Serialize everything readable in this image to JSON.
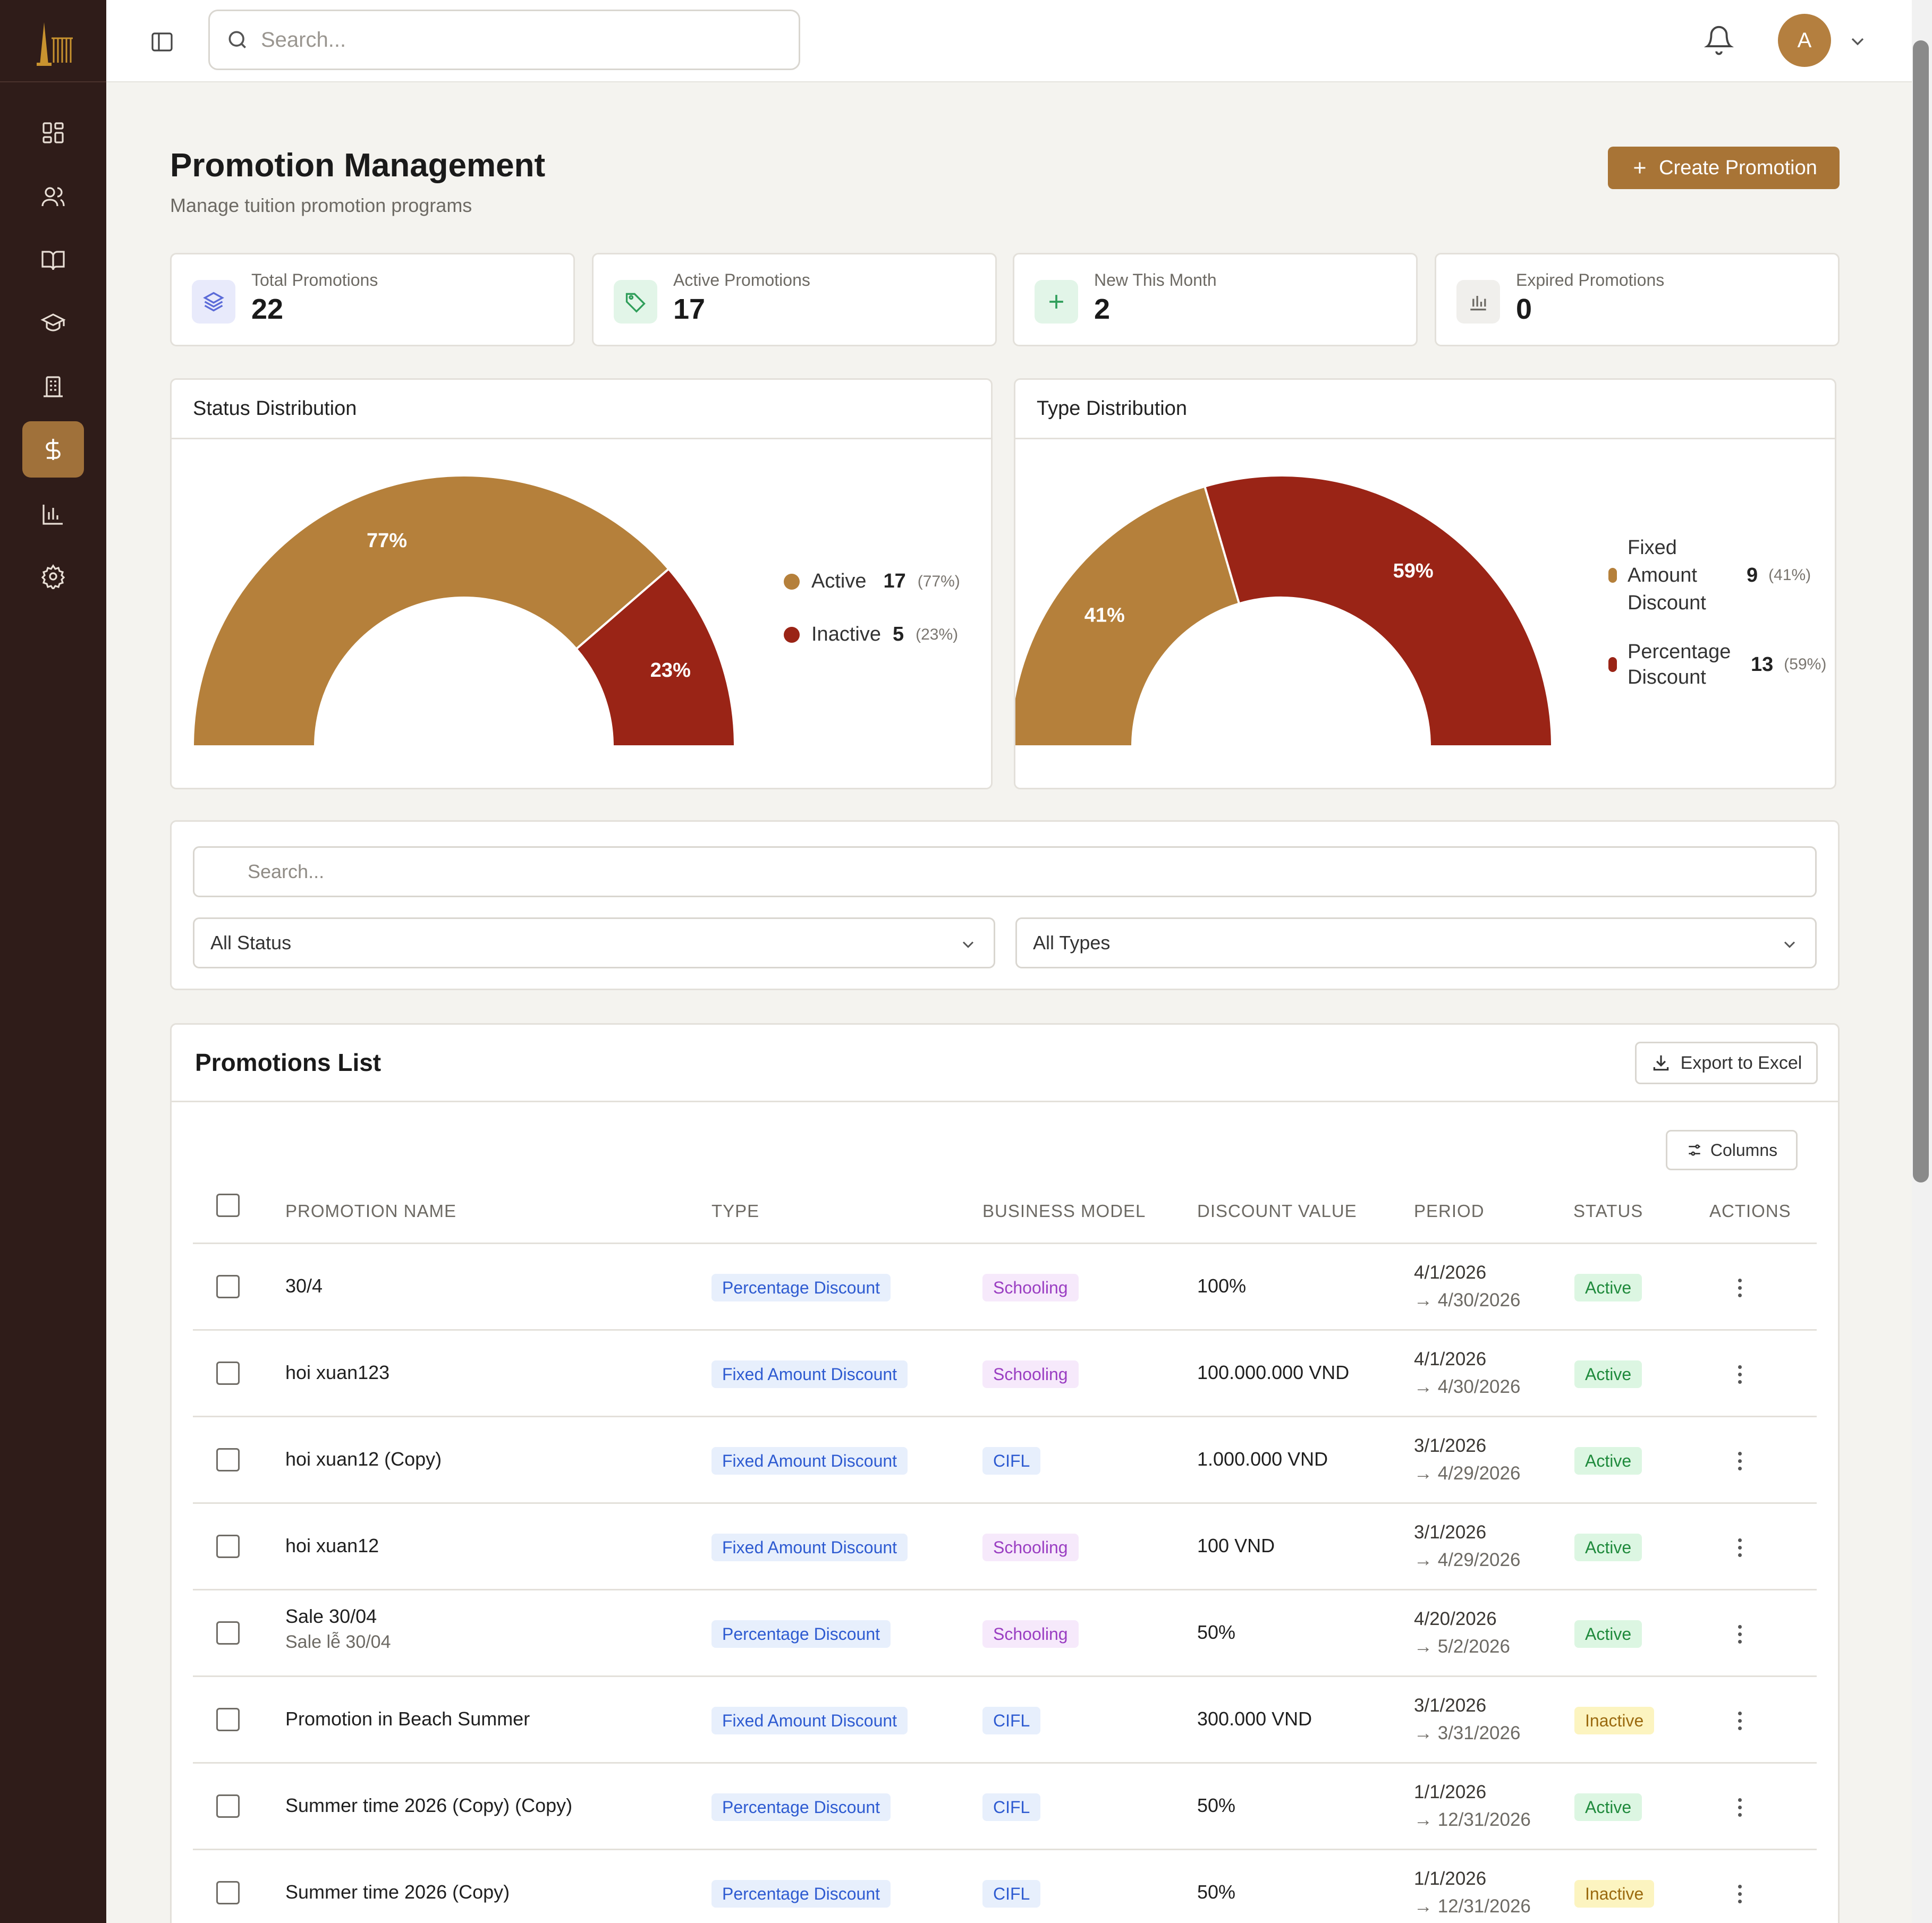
{
  "topbar": {
    "search_placeholder": "Search...",
    "avatar_initial": "A"
  },
  "sidebar": {
    "items": [
      {
        "name": "dashboard",
        "icon": "grid-icon"
      },
      {
        "name": "users",
        "icon": "users-icon"
      },
      {
        "name": "courses",
        "icon": "book-open-icon"
      },
      {
        "name": "students",
        "icon": "graduation-cap-icon"
      },
      {
        "name": "documents",
        "icon": "building-icon"
      },
      {
        "name": "finance",
        "icon": "dollar-icon",
        "active": true
      },
      {
        "name": "reports",
        "icon": "bar-chart-icon"
      },
      {
        "name": "settings",
        "icon": "gear-icon"
      }
    ]
  },
  "page": {
    "title": "Promotion Management",
    "subtitle": "Manage tuition promotion programs",
    "create_label": "Create Promotion"
  },
  "stats": [
    {
      "label": "Total Promotions",
      "value": "22",
      "icon": "layers-icon",
      "color": "#5b6bd8",
      "bg": "#e8eafb"
    },
    {
      "label": "Active Promotions",
      "value": "17",
      "icon": "tag-icon",
      "color": "#2f9e5a",
      "bg": "#e2f5e8"
    },
    {
      "label": "New This Month",
      "value": "2",
      "icon": "plus-icon",
      "color": "#2f9e5a",
      "bg": "#e2f5e8"
    },
    {
      "label": "Expired Promotions",
      "value": "0",
      "icon": "bar-chart-icon",
      "color": "#6d6a64",
      "bg": "#f0efec"
    }
  ],
  "charts": {
    "status": {
      "title": "Status Distribution",
      "legend": [
        {
          "label": "Active",
          "count": "17",
          "pct": "(77%)"
        },
        {
          "label": "Inactive",
          "count": "5",
          "pct": "(23%)"
        }
      ]
    },
    "type": {
      "title": "Type Distribution",
      "legend": [
        {
          "label": "Fixed Amount Discount",
          "count": "9",
          "pct": "(41%)"
        },
        {
          "label": "Percentage Discount",
          "count": "13",
          "pct": "(59%)"
        }
      ]
    }
  },
  "chart_data": [
    {
      "type": "pie",
      "title": "Status Distribution",
      "categories": [
        "Active",
        "Inactive"
      ],
      "values": [
        17,
        5
      ],
      "percent_labels": [
        "77%",
        "23%"
      ],
      "colors": [
        "#b5803b",
        "#9a2416"
      ],
      "style": "semi-donut",
      "legend": "right"
    },
    {
      "type": "pie",
      "title": "Type Distribution",
      "categories": [
        "Fixed Amount Discount",
        "Percentage Discount"
      ],
      "values": [
        9,
        13
      ],
      "percent_labels": [
        "41%",
        "59%"
      ],
      "colors": [
        "#b5803b",
        "#9a2416"
      ],
      "style": "semi-donut",
      "legend": "right"
    }
  ],
  "filters": {
    "search_placeholder": "Search...",
    "status_value": "All Status",
    "type_value": "All Types"
  },
  "list": {
    "title": "Promotions List",
    "export_label": "Export to Excel",
    "columns_label": "Columns",
    "headers": [
      "PROMOTION NAME",
      "TYPE",
      "BUSINESS MODEL",
      "DISCOUNT VALUE",
      "PERIOD",
      "STATUS",
      "ACTIONS"
    ],
    "rows": [
      {
        "name": "30/4",
        "sub": "",
        "type": "Percentage Discount",
        "model": "Schooling",
        "discount": "100%",
        "start": "4/1/2026",
        "end": "→ 4/30/2026",
        "status": "Active"
      },
      {
        "name": "hoi xuan123",
        "sub": "",
        "type": "Fixed Amount Discount",
        "model": "Schooling",
        "discount": "100.000.000 VND",
        "start": "4/1/2026",
        "end": "→ 4/30/2026",
        "status": "Active"
      },
      {
        "name": "hoi xuan12 (Copy)",
        "sub": "",
        "type": "Fixed Amount Discount",
        "model": "CIFL",
        "discount": "1.000.000 VND",
        "start": "3/1/2026",
        "end": "→ 4/29/2026",
        "status": "Active"
      },
      {
        "name": "hoi xuan12",
        "sub": "",
        "type": "Fixed Amount Discount",
        "model": "Schooling",
        "discount": "100 VND",
        "start": "3/1/2026",
        "end": "→ 4/29/2026",
        "status": "Active"
      },
      {
        "name": "Sale 30/04",
        "sub": "Sale lễ 30/04",
        "type": "Percentage Discount",
        "model": "Schooling",
        "discount": "50%",
        "start": "4/20/2026",
        "end": "→ 5/2/2026",
        "status": "Active"
      },
      {
        "name": "Promotion in Beach Summer",
        "sub": "",
        "type": "Fixed Amount Discount",
        "model": "CIFL",
        "discount": "300.000 VND",
        "start": "3/1/2026",
        "end": "→ 3/31/2026",
        "status": "Inactive"
      },
      {
        "name": "Summer time 2026 (Copy) (Copy)",
        "sub": "",
        "type": "Percentage Discount",
        "model": "CIFL",
        "discount": "50%",
        "start": "1/1/2026",
        "end": "→ 12/31/2026",
        "status": "Active"
      },
      {
        "name": "Summer time 2026 (Copy)",
        "sub": "",
        "type": "Percentage Discount",
        "model": "CIFL",
        "discount": "50%",
        "start": "1/1/2026",
        "end": "→ 12/31/2026",
        "status": "Inactive"
      }
    ]
  }
}
